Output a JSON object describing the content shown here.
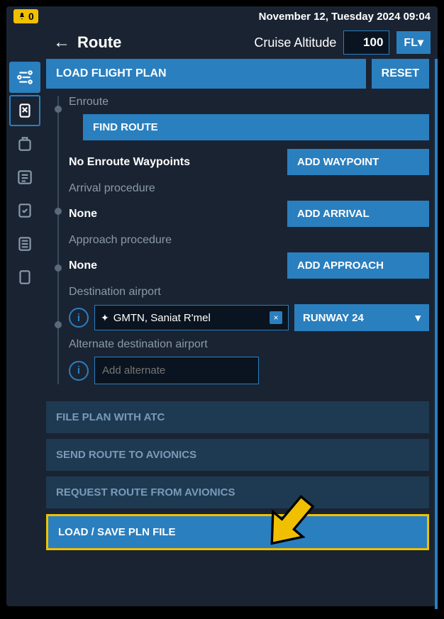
{
  "status_bar": {
    "alert_count": "0",
    "datetime": "November 12, Tuesday 2024 09:04"
  },
  "header": {
    "title": "Route",
    "cruise_label": "Cruise Altitude",
    "cruise_value": "100",
    "fl_label": "FL"
  },
  "actions": {
    "load_plan": "LOAD FLIGHT PLAN",
    "reset": "RESET"
  },
  "enroute": {
    "label": "Enroute",
    "find_route": "FIND ROUTE",
    "no_waypoints": "No Enroute Waypoints",
    "add_waypoint": "ADD WAYPOINT"
  },
  "arrival": {
    "label": "Arrival procedure",
    "value": "None",
    "button": "ADD ARRIVAL"
  },
  "approach": {
    "label": "Approach procedure",
    "value": "None",
    "button": "ADD APPROACH"
  },
  "destination": {
    "label": "Destination airport",
    "airport_value": "GMTN, Saniat R'mel",
    "runway_label": "RUNWAY 24"
  },
  "alternate": {
    "label": "Alternate destination airport",
    "placeholder": "Add alternate"
  },
  "buttons": {
    "file_atc": "FILE PLAN WITH ATC",
    "send_avionics": "SEND ROUTE TO AVIONICS",
    "request_avionics": "REQUEST ROUTE FROM AVIONICS",
    "load_save": "LOAD / SAVE PLN FILE"
  }
}
